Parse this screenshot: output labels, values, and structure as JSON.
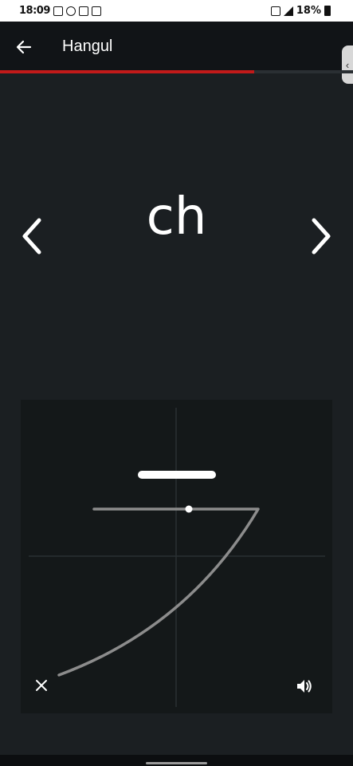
{
  "status_bar": {
    "time": "18:09",
    "battery": "18%"
  },
  "app_bar": {
    "title": "Hangul"
  },
  "lesson": {
    "progress_percent": 72,
    "romanization": "ch"
  },
  "colors": {
    "accent": "#c21a1a",
    "background": "#1b1f22",
    "app_bar": "#111417",
    "canvas": "#141819"
  },
  "icons": {
    "back": "arrow-left-icon",
    "prev": "chevron-left-icon",
    "next": "chevron-right-icon",
    "clear": "close-icon",
    "sound": "volume-icon"
  }
}
